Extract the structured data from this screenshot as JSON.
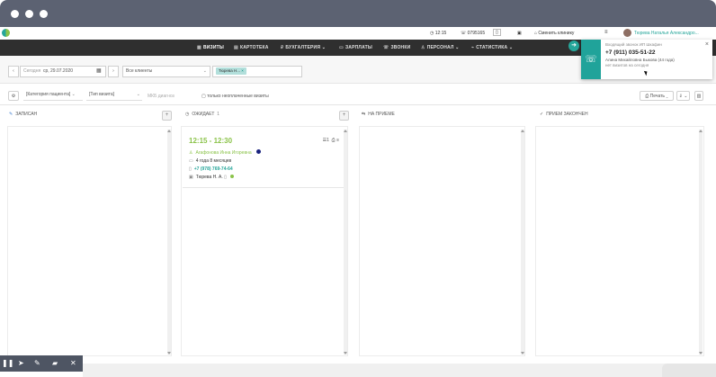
{
  "window": {
    "traffic_dots": [
      "dot-1",
      "dot-2",
      "dot-3"
    ]
  },
  "topbar": {
    "time": "12:15",
    "phone": "0795165",
    "smenalog": "Сменить клинику",
    "user": "Тюрева Наталья Александро..."
  },
  "nav": {
    "items": [
      {
        "label": "ВИЗИТЫ",
        "icon": "▦",
        "active": true
      },
      {
        "label": "КАРТОТЕКА",
        "icon": "▤",
        "active": false
      },
      {
        "label": "БУХГАЛТЕРИЯ ⌄",
        "icon": "₽",
        "active": false
      },
      {
        "label": "ЗАРПЛАТЫ",
        "icon": "▭",
        "active": false
      },
      {
        "label": "ЗВОНКИ",
        "icon": "☏",
        "active": false
      },
      {
        "label": "ПЕРСОНАЛ ⌄",
        "icon": "♙",
        "active": false
      },
      {
        "label": "СТАТИСТИКА ⌄",
        "icon": "⌁",
        "active": false
      }
    ]
  },
  "call_popup": {
    "title": "Входящий звонок ИП Шкафин",
    "phone": "+7 (911) 035-51-22",
    "caller": "Алина Михайловна Быкова (44 года)",
    "note": "нет визитов на сегодня"
  },
  "filters": {
    "today_label": "Сегодня",
    "date_value": "ср, 29.07.2020",
    "clients_placeholder": "Все клиенты",
    "doctor_chip": "Тюрева Н..."
  },
  "toolbar": {
    "category_select": "[Категория пациента]",
    "visit_type_select": "[Тип визита]",
    "diagnosis_placeholder": "МКБ диагноз",
    "only_unpaid": "только неоплаченные визиты",
    "print_label": "Печать ⌄",
    "export_label": "⇓ ⌄",
    "delete_icon_label": "🗑"
  },
  "columns": [
    {
      "title": "ЗАПИСАН",
      "count": "",
      "icon": "✎"
    },
    {
      "title": "ОЖИДАЕТ",
      "count": "1",
      "icon": "◷"
    },
    {
      "title": "НА ПРИЕМЕ",
      "count": "",
      "icon": "⇆"
    },
    {
      "title": "ПРИЕМ ЗАКОНЧЕН",
      "count": "",
      "icon": "✓"
    }
  ],
  "visit_card": {
    "time": "12:15 - 12:30",
    "counter": "1",
    "patient": "Агафонова Инна Игоревна",
    "age": "4 года 8 месяцев",
    "phone": "+7 (978) 769-74-64",
    "doctor": "Тюрева Н. А.",
    "status_dot_color": "#1a237e",
    "doctor_dot_color": "#8bc34a"
  },
  "bottom_toolbar": {
    "icons": [
      "pause-icon",
      "pointer-icon",
      "pen-icon",
      "eraser-icon",
      "close-icon"
    ]
  },
  "colors": {
    "accent": "#20a39a",
    "time_green": "#8bc34a",
    "nav_bg": "#2f2f2f",
    "frame": "#5c6272"
  }
}
